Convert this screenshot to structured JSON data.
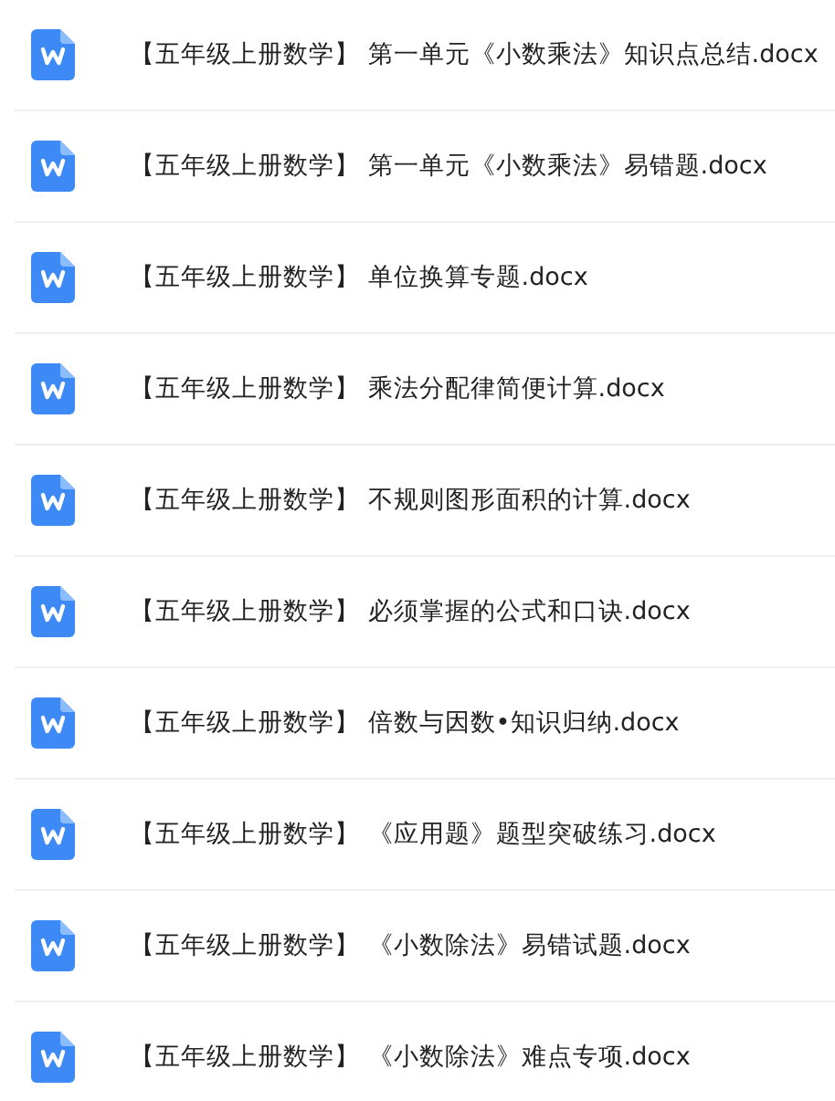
{
  "files": [
    {
      "name": "【五年级上册数学】 第一单元《小数乘法》知识点总结.docx"
    },
    {
      "name": "【五年级上册数学】 第一单元《小数乘法》易错题.docx"
    },
    {
      "name": "【五年级上册数学】 单位换算专题.docx"
    },
    {
      "name": "【五年级上册数学】 乘法分配律简便计算.docx"
    },
    {
      "name": "【五年级上册数学】 不规则图形面积的计算.docx"
    },
    {
      "name": "【五年级上册数学】 必须掌握的公式和口诀.docx"
    },
    {
      "name": "【五年级上册数学】 倍数与因数•知识归纳.docx"
    },
    {
      "name": "【五年级上册数学】 《应用题》题型突破练习.docx"
    },
    {
      "name": "【五年级上册数学】 《小数除法》易错试题.docx"
    },
    {
      "name": "【五年级上册数学】 《小数除法》难点专项.docx"
    }
  ]
}
